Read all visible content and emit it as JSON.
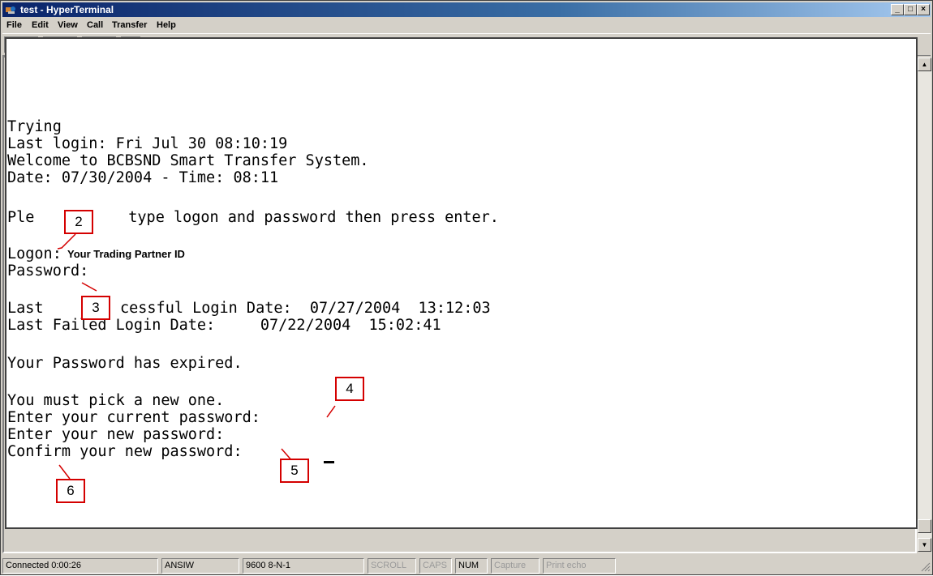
{
  "window": {
    "title": "test - HyperTerminal"
  },
  "menu": {
    "items": [
      {
        "label": "File"
      },
      {
        "label": "Edit"
      },
      {
        "label": "View"
      },
      {
        "label": "Call"
      },
      {
        "label": "Transfer"
      },
      {
        "label": "Help"
      }
    ]
  },
  "toolbar": {
    "buttons": [
      "new-icon",
      "open-icon",
      "connect-icon",
      "disconnect-icon",
      "send-icon",
      "receive-icon",
      "properties-icon"
    ]
  },
  "terminal": {
    "lines": [
      "Trying",
      "Last login: Fri Jul 30 08:10:19",
      "Welcome to BCBSND Smart Transfer System.",
      "Date: 07/30/2004 - Time: 08:11",
      "Ple",
      "  type logon and password then press enter.",
      "Logon:",
      "Password:",
      "Last",
      "cessful Login Date:  07/27/2004  13:12:03",
      "Last Failed Login Date:     07/22/2004  15:02:41",
      "Your Password has expired.",
      "You must pick a new one.",
      "Enter your current password:",
      "Enter your new password:",
      "Confirm your new password:"
    ],
    "logon_hint": "Your Trading Partner ID"
  },
  "callouts": [
    "2",
    "3",
    "4",
    "5",
    "6"
  ],
  "status": {
    "connected": "Connected 0:00:26",
    "emulation": "ANSIW",
    "port": "9600 8-N-1",
    "scroll": "SCROLL",
    "caps": "CAPS",
    "num": "NUM",
    "capture": "Capture",
    "print_echo": "Print echo"
  },
  "colors": {
    "title_bar": "#0a246a",
    "callout_border": "#d40000"
  }
}
